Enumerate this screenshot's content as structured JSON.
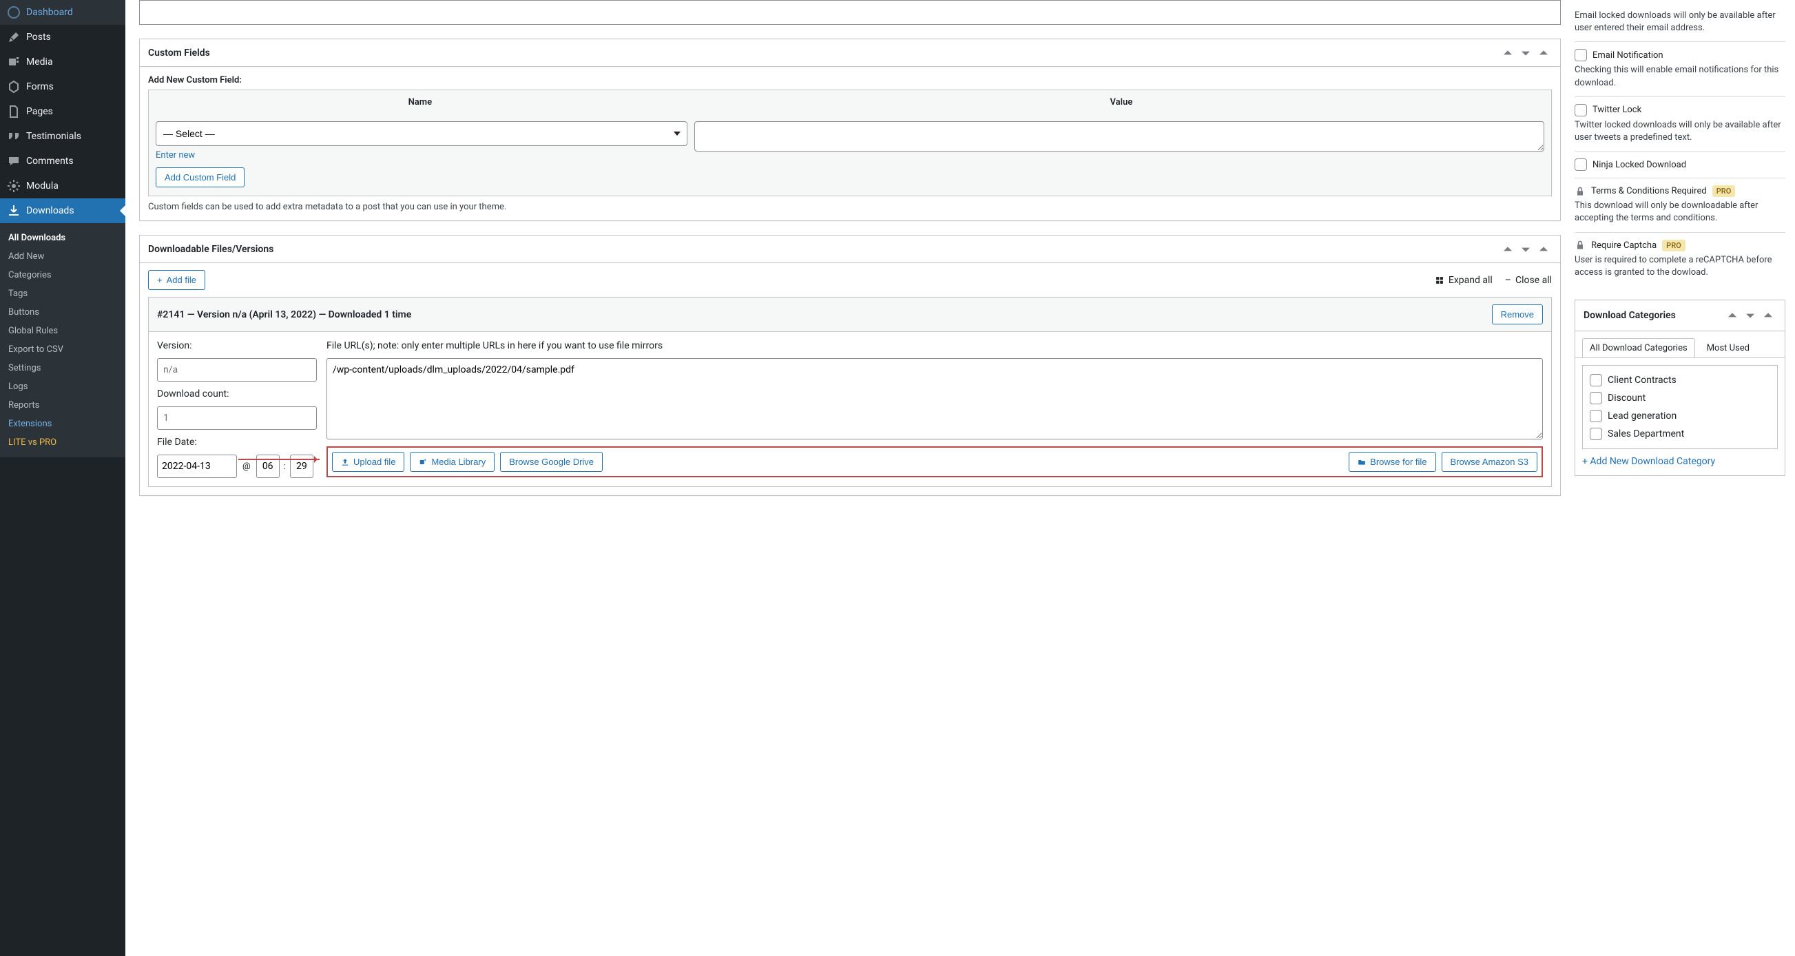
{
  "sidebar": {
    "items": [
      {
        "label": "Dashboard",
        "icon": "dashboard-icon"
      },
      {
        "label": "Posts",
        "icon": "pin-icon"
      },
      {
        "label": "Media",
        "icon": "media-icon"
      },
      {
        "label": "Forms",
        "icon": "forms-icon"
      },
      {
        "label": "Pages",
        "icon": "pages-icon"
      },
      {
        "label": "Testimonials",
        "icon": "quote-icon"
      },
      {
        "label": "Comments",
        "icon": "comment-icon"
      },
      {
        "label": "Modula",
        "icon": "gear-icon"
      },
      {
        "label": "Downloads",
        "icon": "download-icon"
      }
    ],
    "submenu": [
      {
        "label": "All Downloads",
        "class": "active"
      },
      {
        "label": "Add New"
      },
      {
        "label": "Categories"
      },
      {
        "label": "Tags"
      },
      {
        "label": "Buttons"
      },
      {
        "label": "Global Rules"
      },
      {
        "label": "Export to CSV"
      },
      {
        "label": "Settings"
      },
      {
        "label": "Logs"
      },
      {
        "label": "Reports"
      },
      {
        "label": "Extensions",
        "class": "highlight"
      },
      {
        "label": "LITE vs PRO",
        "class": "gold"
      }
    ]
  },
  "custom_fields": {
    "title": "Custom Fields",
    "add_label": "Add New Custom Field:",
    "col_name": "Name",
    "col_value": "Value",
    "select_placeholder": "— Select —",
    "enter_new": "Enter new",
    "add_btn": "Add Custom Field",
    "note": "Custom fields can be used to add extra metadata to a post that you can use in your theme."
  },
  "files": {
    "title": "Downloadable Files/Versions",
    "add_file": "Add file",
    "expand_all": "Expand all",
    "close_all": "Close all",
    "card": {
      "heading": "#2141 — Version n/a (April 13, 2022) — Downloaded 1 time",
      "remove": "Remove",
      "version_label": "Version:",
      "version_placeholder": "n/a",
      "count_label": "Download count:",
      "count_placeholder": "1",
      "date_label": "File Date:",
      "date": "2022-04-13",
      "hour": "06",
      "minute": "29",
      "url_label": "File URL(s); note: only enter multiple URLs in here if you want to use file mirrors",
      "url_value": "/wp-content/uploads/dlm_uploads/2022/04/sample.pdf",
      "btn_upload": "Upload file",
      "btn_media": "Media Library",
      "btn_gdrive": "Browse Google Drive",
      "btn_browse": "Browse for file",
      "btn_s3": "Browse Amazon S3"
    }
  },
  "options": {
    "email_lock_desc": "Email locked downloads will only be available after user entered their email address.",
    "email_notif": "Email Notification",
    "email_notif_desc": "Checking this will enable email notifications for this download.",
    "twitter": "Twitter Lock",
    "twitter_desc": "Twitter locked downloads will only be available after user tweets a predefined text.",
    "ninja": "Ninja Locked Download",
    "terms": "Terms & Conditions Required",
    "terms_desc": "This download will only be downloadable after accepting the terms and conditions.",
    "captcha": "Require Captcha",
    "captcha_desc": "User is required to complete a reCAPTCHA before access is granted to the dowload.",
    "pro": "PRO"
  },
  "categories": {
    "title": "Download Categories",
    "tab_all": "All Download Categories",
    "tab_most": "Most Used",
    "items": [
      "Client Contracts",
      "Discount",
      "Lead generation",
      "Sales Department"
    ],
    "add_new": "+ Add New Download Category"
  }
}
